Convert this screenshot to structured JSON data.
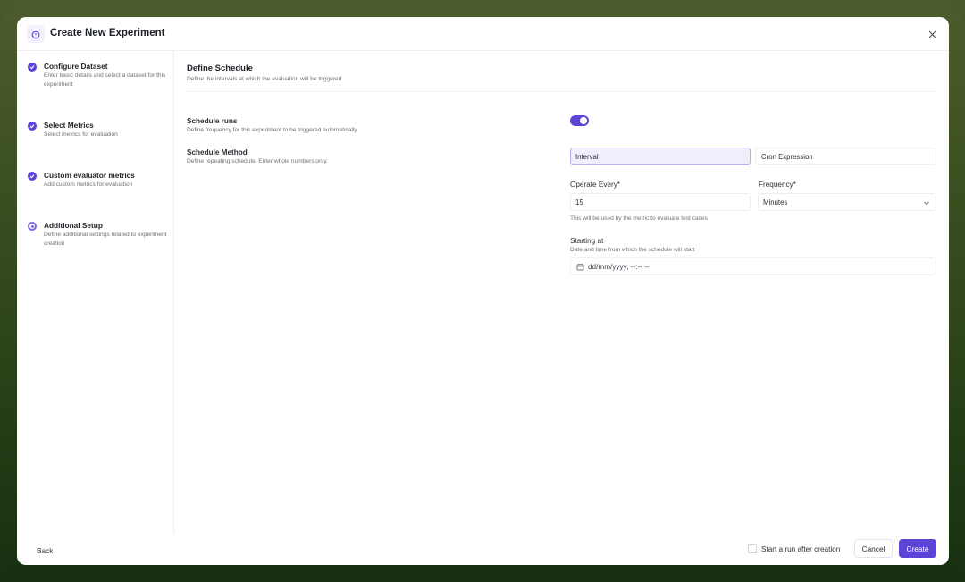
{
  "header": {
    "title": "Create New Experiment",
    "logo_icon": "stopwatch-icon",
    "close_icon": "close-icon"
  },
  "steps": [
    {
      "title": "Configure Dataset",
      "desc": "Enter basic details and select a dataset for this experiment",
      "status": "complete"
    },
    {
      "title": "Select Metrics",
      "desc": "Select metrics for evaluation",
      "status": "complete"
    },
    {
      "title": "Custom evaluator metrics",
      "desc": "Add custom metrics for evaluation",
      "status": "complete"
    },
    {
      "title": "Additional Setup",
      "desc": "Define additional settings related to experiment creation",
      "status": "current"
    }
  ],
  "section": {
    "title": "Define Schedule",
    "desc": "Define the intervals at which the evaluation will be triggered"
  },
  "schedule_runs": {
    "label": "Schedule runs",
    "desc": "Define frequency for this experiment to be triggered automatically",
    "enabled": true
  },
  "schedule_method": {
    "label": "Schedule Method",
    "desc": "Define repeating schedule. Enter whole numbers only.",
    "options": [
      "Interval",
      "Cron Expression"
    ],
    "selected": "Interval"
  },
  "operate_every": {
    "label": "Operate Every*",
    "value": "15",
    "hint": "This will be used by the metric to evaluate test cases"
  },
  "frequency": {
    "label": "Frequency*",
    "value": "Minutes"
  },
  "starting_at": {
    "label": "Starting at",
    "desc": "Date and time from which the schedule will start",
    "placeholder": "dd/mm/yyyy, --:-- --"
  },
  "footer": {
    "back": "Back",
    "start_run_label": "Start a run after creation",
    "cancel": "Cancel",
    "create": "Create"
  },
  "colors": {
    "accent": "#5b45d6"
  }
}
